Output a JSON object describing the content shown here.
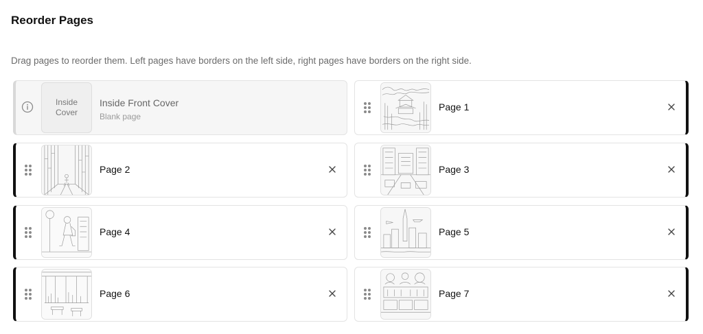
{
  "header": {
    "title": "Reorder Pages",
    "description": "Drag pages to reorder them. Left pages have borders on the left side, right pages have borders on the right side."
  },
  "cover": {
    "thumb_line1": "Inside",
    "thumb_line2": "Cover",
    "title": "Inside Front Cover",
    "subtitle": "Blank page",
    "icon": "info-icon"
  },
  "pages": [
    {
      "label": "Page 1",
      "side": "right",
      "illustration": "temple-in-forest"
    },
    {
      "label": "Page 2",
      "side": "left",
      "illustration": "bamboo-forest-walk"
    },
    {
      "label": "Page 3",
      "side": "right",
      "illustration": "city-street"
    },
    {
      "label": "Page 4",
      "side": "left",
      "illustration": "girl-walking-city"
    },
    {
      "label": "Page 5",
      "side": "right",
      "illustration": "skyline-with-plane"
    },
    {
      "label": "Page 6",
      "side": "left",
      "illustration": "office-window-view"
    },
    {
      "label": "Page 7",
      "side": "right",
      "illustration": "market-shop"
    }
  ],
  "icons": {
    "drag": "drag-handle-icon",
    "remove": "close-icon"
  },
  "colors": {
    "page_border": "#111111",
    "cover_border": "#d8d8d8",
    "muted_text": "#6b6b6b"
  }
}
